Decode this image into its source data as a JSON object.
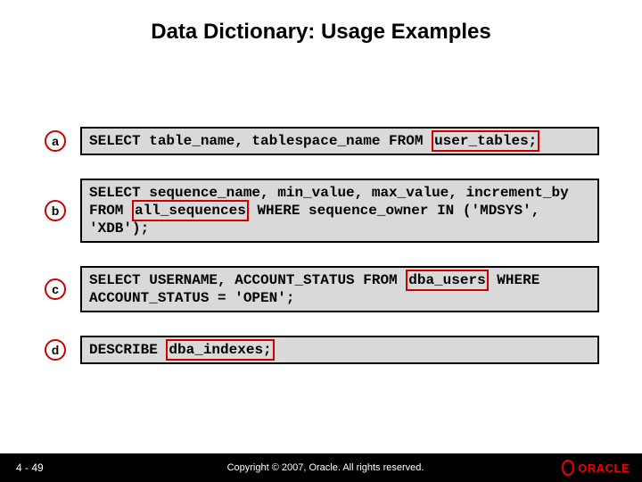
{
  "title": "Data Dictionary: Usage Examples",
  "examples": [
    {
      "badge": "a",
      "code_pre": "SELECT table_name, tablespace_name FROM ",
      "code_hl": "user_tables;",
      "code_post": "",
      "highlight_keyword": "user_tables"
    },
    {
      "badge": "b",
      "code_pre": "SELECT sequence_name, min_value, max_value, increment_by FROM ",
      "code_hl": "all_sequences",
      "code_post": " WHERE sequence_owner IN ('MDSYS', 'XDB');",
      "highlight_keyword": "all_sequences"
    },
    {
      "badge": "c",
      "code_pre": "SELECT USERNAME, ACCOUNT_STATUS FROM ",
      "code_hl": "dba_users",
      "code_post": " WHERE ACCOUNT_STATUS = 'OPEN';",
      "highlight_keyword": "dba_users"
    },
    {
      "badge": "d",
      "code_pre": "DESCRIBE ",
      "code_hl": "dba_indexes;",
      "code_post": "",
      "highlight_keyword": "dba_indexes"
    }
  ],
  "footer": {
    "page": "4 - 49",
    "copyright": "Copyright © 2007, Oracle. All rights reserved.",
    "logo_text": "ORACLE"
  }
}
